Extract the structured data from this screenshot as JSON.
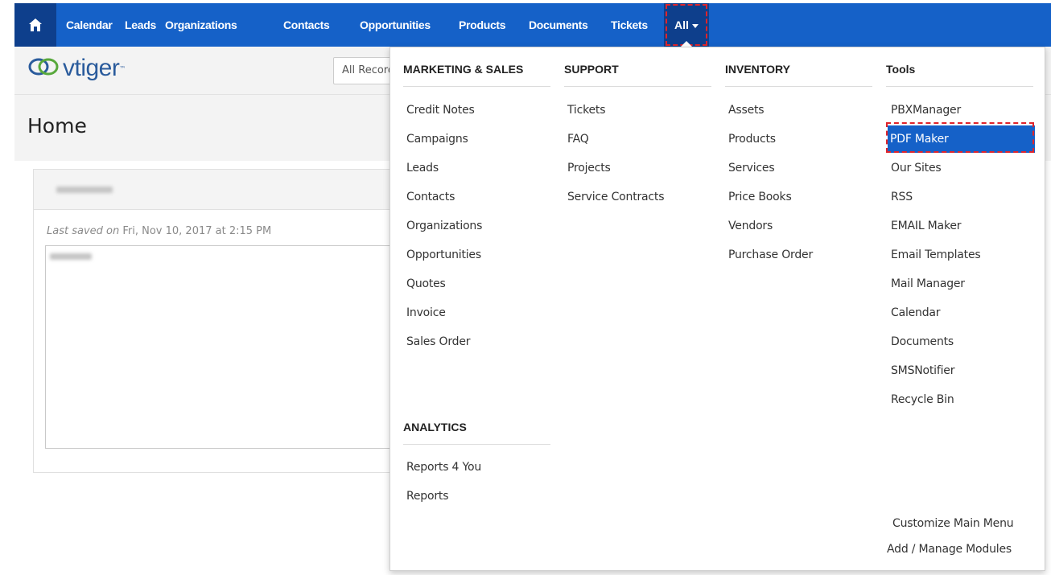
{
  "nav": {
    "items": [
      "Calendar",
      "Leads",
      "Organizations",
      "Contacts",
      "Opportunities",
      "Products",
      "Documents",
      "Tickets"
    ],
    "all_label": "All"
  },
  "logo": {
    "text": "vtiger"
  },
  "search": {
    "placeholder": "All Records"
  },
  "page": {
    "title": "Home"
  },
  "widget": {
    "saved_prefix": "Last saved on",
    "saved_date": " Fri, Nov 10, 2017 at 2:15 PM"
  },
  "menu": {
    "marketing": {
      "heading": "MARKETING & SALES",
      "items": [
        "Credit Notes",
        "Campaigns",
        "Leads",
        "Contacts",
        "Organizations",
        "Opportunities",
        "Quotes",
        "Invoice",
        "Sales Order"
      ]
    },
    "analytics": {
      "heading": "ANALYTICS",
      "items": [
        "Reports 4 You",
        "Reports"
      ]
    },
    "support": {
      "heading": "SUPPORT",
      "items": [
        "Tickets",
        "FAQ",
        "Projects",
        "Service Contracts"
      ]
    },
    "inventory": {
      "heading": "INVENTORY",
      "items": [
        "Assets",
        "Products",
        "Services",
        "Price Books",
        "Vendors",
        "Purchase Order"
      ]
    },
    "tools": {
      "heading": "Tools",
      "items": [
        "PBXManager",
        "PDF Maker",
        "Our Sites",
        "RSS",
        "EMAIL Maker",
        "Email Templates",
        "Mail Manager",
        "Calendar",
        "Documents",
        "SMSNotifier",
        "Recycle Bin"
      ],
      "active_item": "PDF Maker"
    },
    "footer": {
      "customize": "Customize Main Menu",
      "manage": "Add / Manage Modules"
    }
  },
  "colors": {
    "nav_bg": "#1561c8",
    "nav_active_bg": "#0e3f8c",
    "highlight_border": "#e0242b"
  }
}
